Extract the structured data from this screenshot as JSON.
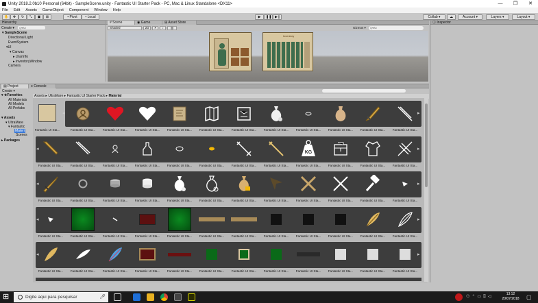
{
  "title": "Unity 2018.2.0b10 Personal (64bit) - SampleScene.unity - Fantastic UI Starter Pack - PC, Mac & Linux Standalone <DX11>",
  "window_controls": [
    "—",
    "❐",
    "✕"
  ],
  "menu": [
    "File",
    "Edit",
    "Assets",
    "GameObject",
    "Component",
    "Window",
    "Help"
  ],
  "toolbar": {
    "pivot": "Pivot",
    "local": "Local",
    "collab": "Collab ▾",
    "account": "Account ▾",
    "layers": "Layers ▾",
    "layout": "Layout ▾"
  },
  "hierarchy": {
    "tab": "Hierarchy",
    "create": "Create ▾",
    "search": "Q▾All",
    "items": [
      "SampleScene",
      "Directional Light",
      "EventSystem",
      "UI",
      "Canvas",
      "charInfo",
      "InventoryWindow",
      "Camera"
    ]
  },
  "scene_tabs": [
    "Scene",
    "Game",
    "Asset Store"
  ],
  "scene_bar": {
    "shading": "Shaded",
    "mode": "2D",
    "gizmos": "Gizmos ▾",
    "search": "Q▾All"
  },
  "scene_window": {
    "right_title": "Inventory"
  },
  "inspector": {
    "tab": "Inspector"
  },
  "project": {
    "tabs": [
      "Project",
      "Console"
    ],
    "create": "Create ▾",
    "breadcrumb": [
      "Assets",
      "UltraMare",
      "Fantastic UI Starter Pack",
      "Material"
    ]
  },
  "tree": {
    "favorites": "Favorites",
    "fav_items": [
      "All Materials",
      "All Models",
      "All Prefabs"
    ],
    "assets": "Assets",
    "asset_items": [
      "UltraMare",
      "Fantastic",
      "Materi",
      "Scenes"
    ],
    "packages": "Packages"
  },
  "asset_label": "Fantastic UI Sta...",
  "icon_label": {
    "kg": "KG"
  },
  "taskbar": {
    "search": "Digite aqui para pesquisar",
    "time": "13:12",
    "date": "20/07/2018"
  }
}
